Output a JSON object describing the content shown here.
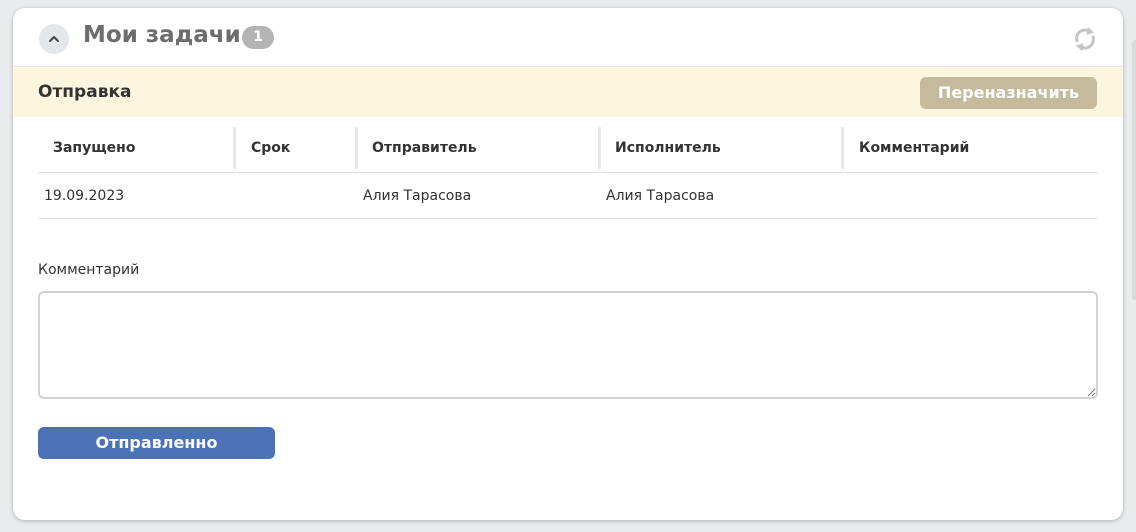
{
  "widget": {
    "title": "Мои задачи",
    "count": "1",
    "collapse_icon": "chevron-up-icon",
    "refresh_icon": "refresh-icon"
  },
  "task": {
    "title": "Отправка",
    "reassign_label": "Переназначить"
  },
  "table": {
    "headers": [
      "Запущено",
      "Срок",
      "Отправитель",
      "Исполнитель",
      "Комментарий"
    ],
    "rows": [
      {
        "started": "19.09.2023",
        "deadline": "",
        "sender": "Алия Тарасова",
        "assignee": "Алия Тарасова",
        "comment": ""
      }
    ]
  },
  "comment_form": {
    "label": "Комментарий",
    "value": "",
    "placeholder": "",
    "submit_label": "Отправленно"
  },
  "colors": {
    "accent": "#4b72b7",
    "task_bar": "#fdf6de",
    "reassign": "#c5ba9b",
    "badge": "#b4b4b4"
  }
}
